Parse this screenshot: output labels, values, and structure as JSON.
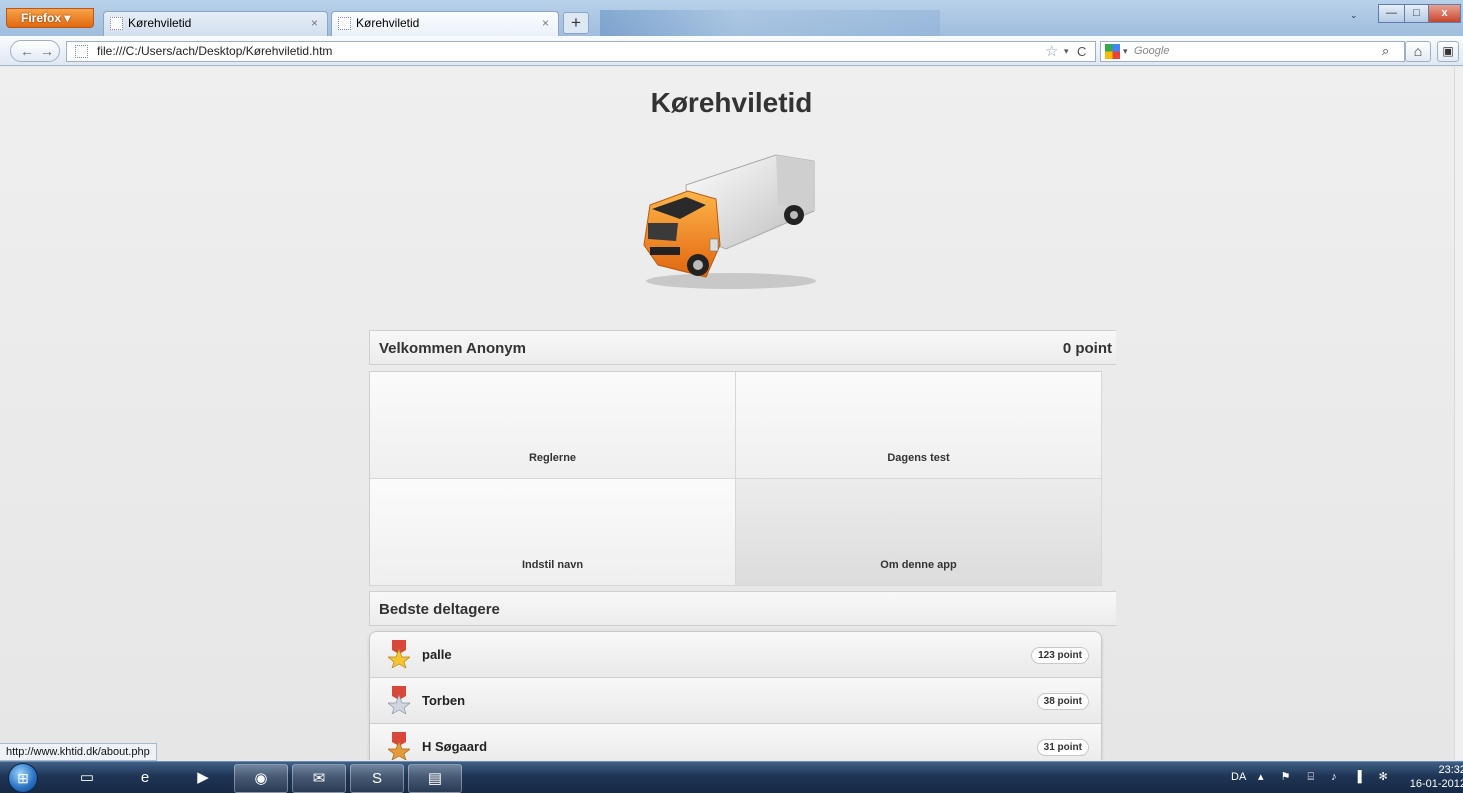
{
  "browser": {
    "menu_button": "Firefox ▾",
    "tabs": [
      {
        "title": "Kørehviletid",
        "close": "×"
      },
      {
        "title": "Kørehviletid",
        "close": "×"
      }
    ],
    "new_tab": "+",
    "tab_list": "⌄",
    "window_controls": {
      "minimize": "—",
      "maximize": "□",
      "close": "x"
    },
    "url": "file:///C:/Users/ach/Desktop/Kørehviletid.htm",
    "nav_arrows": "←→",
    "search_placeholder": "Google",
    "search_engine_arrow": "▾",
    "url_star": "☆",
    "url_dropdown": "▾",
    "reload": "C",
    "search_go": "⌕",
    "home": "⌂",
    "addon": "▣",
    "status_url": "http://www.khtid.dk/about.php"
  },
  "page": {
    "title": "Kørehviletid",
    "welcome": "Velkommen Anonym",
    "points": "0 point",
    "menu": [
      {
        "label": "Reglerne"
      },
      {
        "label": "Dagens test"
      },
      {
        "label": "Indstil navn"
      },
      {
        "label": "Om denne app"
      }
    ],
    "best_title": "Bedste deltagere",
    "leaderboard": [
      {
        "name": "palle",
        "points": "123 point"
      },
      {
        "name": "Torben",
        "points": "38 point"
      },
      {
        "name": "H Søgaard",
        "points": "31 point"
      }
    ]
  },
  "taskbar": {
    "start": "⊞",
    "apps": [
      {
        "icon": "file-explorer-icon",
        "glyph": "▭"
      },
      {
        "icon": "internet-explorer-icon",
        "glyph": "e"
      },
      {
        "icon": "media-player-icon",
        "glyph": "▶"
      },
      {
        "icon": "firefox-icon",
        "glyph": "◉"
      },
      {
        "icon": "outlook-icon",
        "glyph": "✉"
      },
      {
        "icon": "skype-icon",
        "glyph": "S"
      },
      {
        "icon": "presentation-app-icon",
        "glyph": "▤"
      }
    ],
    "language": "DA",
    "tray_icons": "▴ ⚑ ⌸ ♪ ▐ ✻",
    "time": "23:32",
    "date": "16-01-2012"
  },
  "colors": {
    "firefox_orange": "#e1690f",
    "taskbar_blue": "#1e3554",
    "truck_cab": "#f08a1c",
    "page_background": "#e9e9e9"
  }
}
